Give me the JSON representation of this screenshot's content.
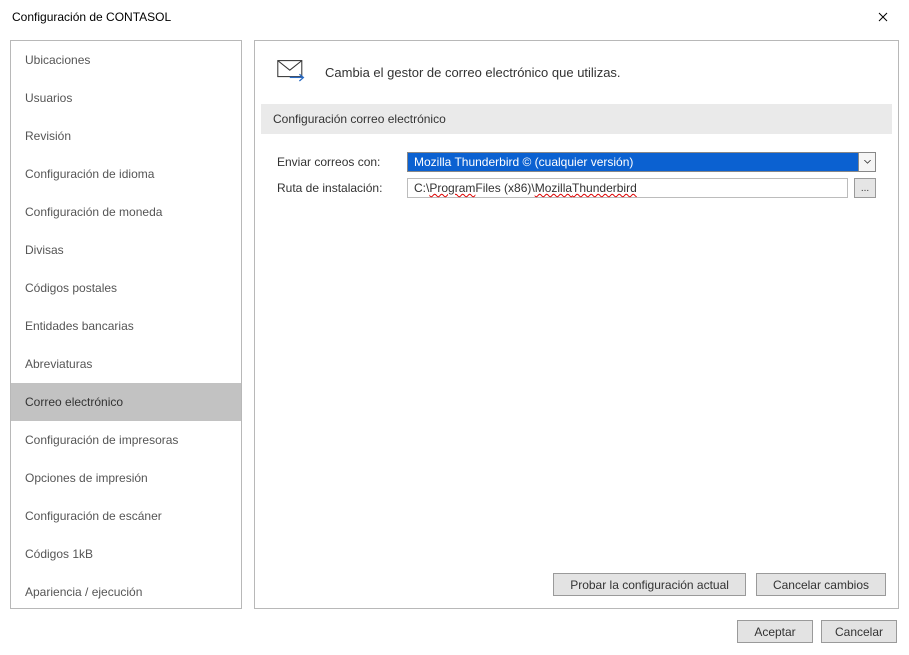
{
  "window": {
    "title": "Configuración de CONTASOL"
  },
  "sidebar": {
    "items": [
      {
        "label": "Ubicaciones"
      },
      {
        "label": "Usuarios"
      },
      {
        "label": "Revisión"
      },
      {
        "label": "Configuración de idioma"
      },
      {
        "label": "Configuración de moneda"
      },
      {
        "label": "Divisas"
      },
      {
        "label": "Códigos postales"
      },
      {
        "label": "Entidades bancarias"
      },
      {
        "label": "Abreviaturas"
      },
      {
        "label": "Correo electrónico"
      },
      {
        "label": "Configuración de impresoras"
      },
      {
        "label": "Opciones de impresión"
      },
      {
        "label": "Configuración de escáner"
      },
      {
        "label": "Códigos 1kB"
      },
      {
        "label": "Apariencia / ejecución"
      }
    ],
    "selected_index": 9
  },
  "main": {
    "header_text": "Cambia el gestor de correo electrónico que utilizas.",
    "section_title": "Configuración correo electrónico",
    "send_with_label": "Enviar correos con:",
    "send_with_value": "Mozilla Thunderbird © (cualquier versión)",
    "install_path_label": "Ruta de instalación:",
    "install_path_prefix": "C:\\",
    "install_path_seg1": "Program",
    "install_path_seg2": " Files (x86)\\",
    "install_path_seg3": "Mozilla",
    "install_path_seg4": " ",
    "install_path_seg5": "Thunderbird",
    "browse_label": "..."
  },
  "panel_buttons": {
    "test": "Probar la configuración actual",
    "cancel_changes": "Cancelar cambios"
  },
  "dialog_buttons": {
    "accept": "Aceptar",
    "cancel": "Cancelar"
  }
}
